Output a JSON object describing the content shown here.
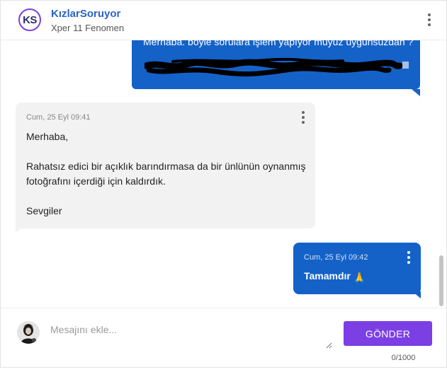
{
  "header": {
    "logo_text": "KS",
    "name": "KızlarSoruyor",
    "subtitle": "Xper 11 Fenomen",
    "menu_icon": "vertical-dots-icon"
  },
  "messages": [
    {
      "direction": "outgoing",
      "text": "Merhaba. böyle sorulara işlem yapıyor muyuz uygunsuzdan ?",
      "redacted_link": true
    },
    {
      "direction": "incoming",
      "timestamp": "Cum, 25 Eyl 09:41",
      "lines": [
        "Merhaba,",
        "",
        "Rahatsız edici bir açıklık barındırmasa da bir ünlünün oynanmış",
        "fotoğrafını içerdiği için kaldırdık.",
        "",
        "Sevgiler"
      ]
    },
    {
      "direction": "outgoing",
      "timestamp": "Cum, 25 Eyl 09:42",
      "text": "Tamamdır",
      "emoji": "🙏"
    }
  ],
  "composer": {
    "placeholder": "Mesajını ekle...",
    "send_label": "GÖNDER",
    "counter": "0/1000"
  },
  "colors": {
    "accent": "#7b3fe4",
    "outgoing_bubble": "#1462c8",
    "incoming_bubble": "#f2f2f2",
    "brand_text": "#2b63c6"
  }
}
